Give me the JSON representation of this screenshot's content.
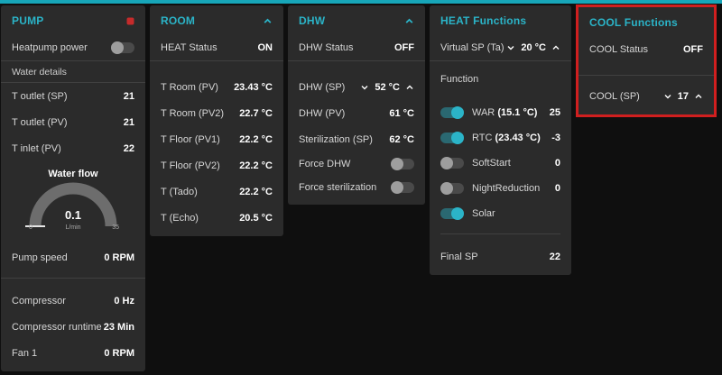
{
  "theme": {
    "accent": "#2bb4c8",
    "top_bar": "#17a6b9",
    "annotation_red": "#d01f1f"
  },
  "pump": {
    "title": "PUMP",
    "power": {
      "label": "Heatpump power",
      "on": false
    },
    "section_label": "Water details",
    "temps": [
      {
        "label": "T outlet (SP)",
        "value": "21"
      },
      {
        "label": "T outlet (PV)",
        "value": "21"
      },
      {
        "label": "T inlet (PV)",
        "value": "22"
      }
    ],
    "gauge": {
      "title": "Water flow",
      "value": "0.1",
      "unit": "L/min",
      "min": "0",
      "max": "35"
    },
    "pump_speed": {
      "label": "Pump speed",
      "value": "0 RPM"
    },
    "stats": [
      {
        "label": "Compressor",
        "value": "0 Hz"
      },
      {
        "label": "Compressor runtime",
        "value": "23 Min"
      },
      {
        "label": "Fan 1",
        "value": "0 RPM"
      }
    ]
  },
  "room": {
    "title": "ROOM",
    "status": {
      "label": "HEAT Status",
      "value": "ON"
    },
    "temps": [
      {
        "label": "T Room (PV)",
        "value": "23.43 °C"
      },
      {
        "label": "T Room (PV2)",
        "value": "22.7 °C"
      },
      {
        "label": "T Floor (PV1)",
        "value": "22.2 °C"
      },
      {
        "label": "T Floor (PV2)",
        "value": "22.2 °C"
      },
      {
        "label": "T (Tado)",
        "value": "22.2 °C"
      },
      {
        "label": "T (Echo)",
        "value": "20.5 °C"
      }
    ]
  },
  "dhw": {
    "title": "DHW",
    "status": {
      "label": "DHW Status",
      "value": "OFF"
    },
    "setpoint": {
      "label": "DHW (SP)",
      "value": "52 °C"
    },
    "readings": [
      {
        "label": "DHW (PV)",
        "value": "61 °C"
      },
      {
        "label": "Sterilization (SP)",
        "value": "62 °C"
      }
    ],
    "switches": [
      {
        "label": "Force DHW",
        "on": false
      },
      {
        "label": "Force sterilization",
        "on": false
      }
    ]
  },
  "heat": {
    "title": "HEAT Functions",
    "setpoint": {
      "label": "Virtual SP (Ta)",
      "value": "20 °C"
    },
    "section_label": "Function",
    "functions": [
      {
        "label": "WAR",
        "detail": "(15.1 °C)",
        "value": "25",
        "on": true
      },
      {
        "label": "RTC",
        "detail": "(23.43 °C)",
        "value": "-3",
        "on": true
      },
      {
        "label": "SoftStart",
        "detail": "",
        "value": "0",
        "on": false
      },
      {
        "label": "NightReduction",
        "detail": "",
        "value": "0",
        "on": false
      },
      {
        "label": "Solar",
        "detail": "",
        "value": "",
        "on": true
      }
    ],
    "final": {
      "label": "Final SP",
      "value": "22"
    }
  },
  "cool": {
    "title": "COOL Functions",
    "status": {
      "label": "COOL Status",
      "value": "OFF"
    },
    "setpoint": {
      "label": "COOL (SP)",
      "value": "17"
    }
  }
}
